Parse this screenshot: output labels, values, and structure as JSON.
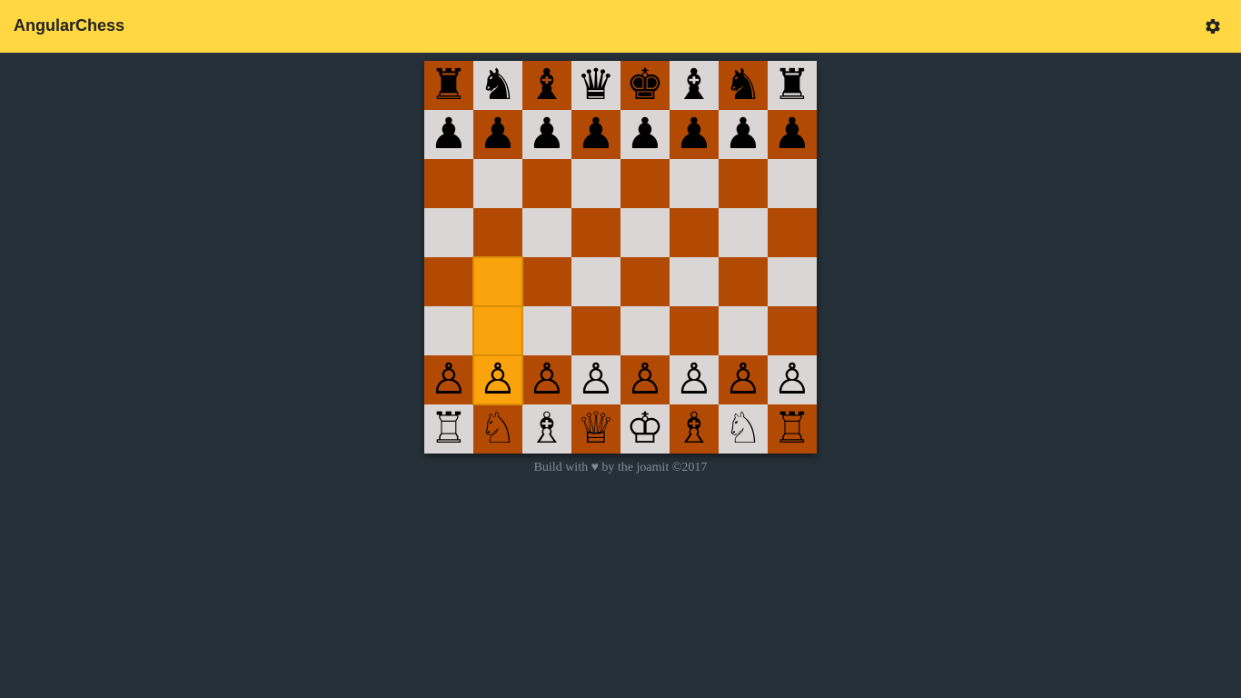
{
  "app": {
    "title": "AngularChess",
    "settings_icon": "gear-icon"
  },
  "colors": {
    "toolbar": "#ffd740",
    "background": "#263038",
    "light_square": "#dad6d6",
    "dark_square": "#b34a04",
    "highlight": "#fba30d"
  },
  "board": {
    "rows": [
      [
        "♜",
        "♞",
        "♝",
        "♛",
        "♚",
        "♝",
        "♞",
        "♜"
      ],
      [
        "♟",
        "♟",
        "♟",
        "♟",
        "♟",
        "♟",
        "♟",
        "♟"
      ],
      [
        "",
        "",
        "",
        "",
        "",
        "",
        "",
        ""
      ],
      [
        "",
        "",
        "",
        "",
        "",
        "",
        "",
        ""
      ],
      [
        "",
        "",
        "",
        "",
        "",
        "",
        "",
        ""
      ],
      [
        "",
        "",
        "",
        "",
        "",
        "",
        "",
        ""
      ],
      [
        "♙",
        "♙",
        "♙",
        "♙",
        "♙",
        "♙",
        "♙",
        "♙"
      ],
      [
        "♖",
        "♘",
        "♗",
        "♕",
        "♔",
        "♗",
        "♘",
        "♖"
      ]
    ],
    "highlighted_squares": [
      "b2",
      "b3",
      "b4"
    ]
  },
  "footer": {
    "text": "Build with ♥ by the joamit ©2017"
  }
}
